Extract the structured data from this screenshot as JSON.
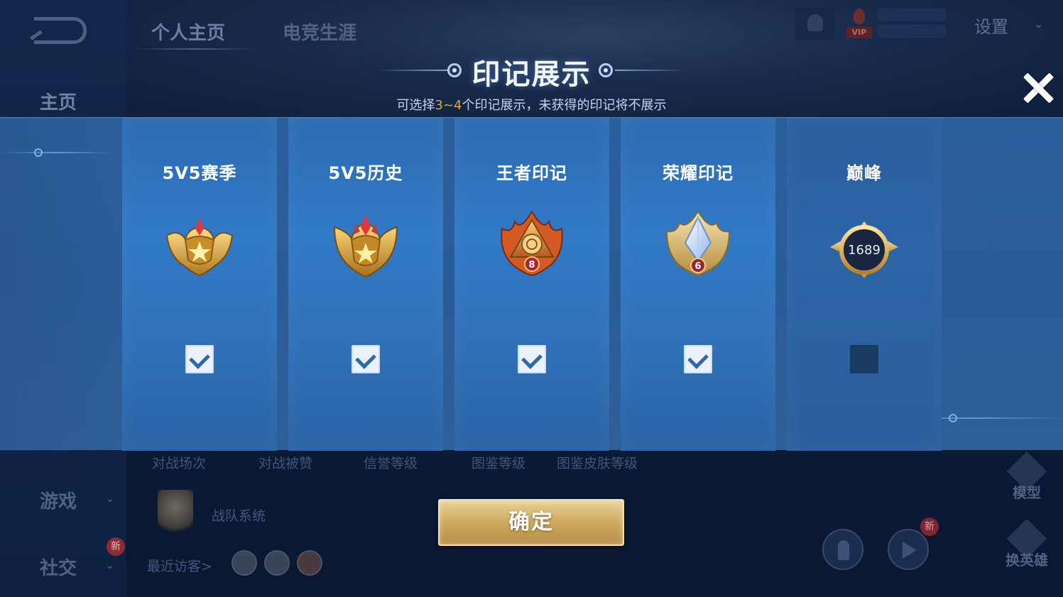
{
  "background": {
    "back_label": "",
    "tabs": [
      {
        "label": "个人主页"
      },
      {
        "label": "电竞生涯"
      }
    ],
    "nav": {
      "home": "主页",
      "game": "游戏",
      "social": "社交",
      "new_badge": "新"
    },
    "stats_labels": [
      "对战场次",
      "对战被赞",
      "信誉等级",
      "图鉴等级",
      "图鉴皮肤等级"
    ],
    "team_label": "战队系统",
    "recent_visitors": "最近访客>",
    "settings_label": "设置",
    "vip_label": "VIP",
    "right_icons": [
      {
        "label": "模型"
      },
      {
        "label": "换英雄"
      }
    ],
    "new_badge_2": "新"
  },
  "modal": {
    "title": "印记展示",
    "subtitle_prefix": "可选择",
    "subtitle_highlight": "3~4",
    "subtitle_suffix": "个印记展示，未获得的印记将不展示",
    "cards": [
      {
        "title": "5V5赛季",
        "badge": "gold-star-shield-badge",
        "checked": true
      },
      {
        "title": "5V5历史",
        "badge": "gold-star-wing-badge",
        "checked": true
      },
      {
        "title": "王者印记",
        "badge": "king-flame-badge",
        "badge_number": "8",
        "checked": true
      },
      {
        "title": "荣耀印记",
        "badge": "glory-crystal-badge",
        "badge_number": "6",
        "checked": true
      },
      {
        "title": "巅峰",
        "badge": "peak-orb-badge",
        "badge_number": "1689",
        "checked": false
      }
    ],
    "confirm_label": "确定"
  },
  "colors": {
    "panel_blue": "#2b5f9c",
    "card_blue": "#3179c6",
    "gold_button": "#cfae63",
    "highlight_orange": "#e3a73f",
    "check_blue": "#2d67ad"
  }
}
